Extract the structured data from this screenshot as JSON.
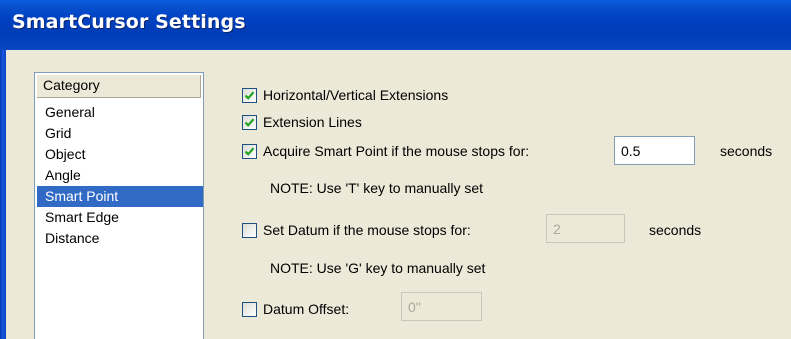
{
  "window": {
    "title": "SmartCursor Settings"
  },
  "category": {
    "header": "Category",
    "items": [
      "General",
      "Grid",
      "Object",
      "Angle",
      "Smart Point",
      "Smart Edge",
      "Distance"
    ],
    "selected": "Smart Point"
  },
  "options": {
    "hv_extensions": {
      "label": "Horizontal/Vertical Extensions",
      "checked": true
    },
    "extension_lines": {
      "label": "Extension Lines",
      "checked": true
    },
    "acquire_smart_point": {
      "label": "Acquire Smart Point if the mouse stops for:",
      "checked": true,
      "value": "0.5",
      "unit": "seconds"
    },
    "acquire_note": "NOTE: Use 'T' key to manually set",
    "set_datum": {
      "label": "Set Datum if the mouse stops for:",
      "checked": false,
      "value": "2",
      "unit": "seconds"
    },
    "datum_note": "NOTE: Use 'G' key to manually set",
    "datum_offset": {
      "label": "Datum Offset:",
      "checked": false,
      "value": "0\""
    }
  },
  "colors": {
    "title_bar": "#0042c2",
    "selection": "#316ac5",
    "dialog_bg": "#ece9d8"
  },
  "icons": {
    "check": "check-mark-icon"
  }
}
